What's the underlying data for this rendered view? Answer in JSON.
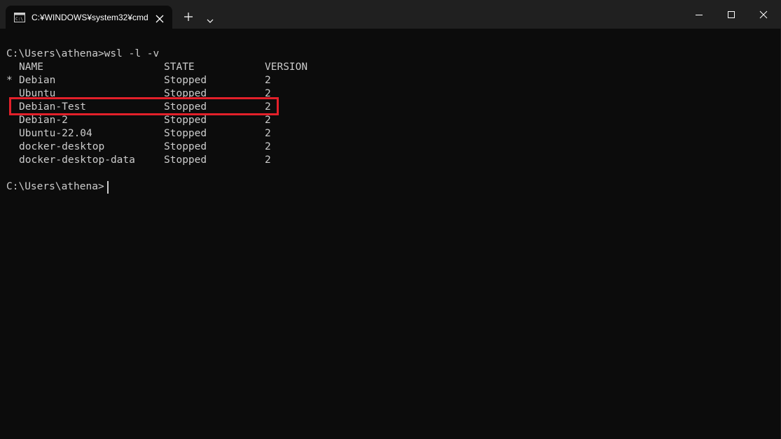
{
  "window": {
    "tab_title": "C:¥WINDOWS¥system32¥cmd",
    "tab_icon": "console-icon",
    "new_tab_icon": "plus-icon",
    "dropdown_icon": "chevron-down-icon",
    "controls": [
      "minimize-icon",
      "maximize-icon",
      "close-icon"
    ]
  },
  "console": {
    "command_line": "C:\\Users\\athena>wsl -l -v",
    "headers": {
      "name": "NAME",
      "state": "STATE",
      "version": "VERSION"
    },
    "rows": [
      {
        "marker": "*",
        "name": "Debian",
        "state": "Stopped",
        "version": "2"
      },
      {
        "marker": "",
        "name": "Ubuntu",
        "state": "Stopped",
        "version": "2"
      },
      {
        "marker": "",
        "name": "Debian-Test",
        "state": "Stopped",
        "version": "2"
      },
      {
        "marker": "",
        "name": "Debian-2",
        "state": "Stopped",
        "version": "2"
      },
      {
        "marker": "",
        "name": "Ubuntu-22.04",
        "state": "Stopped",
        "version": "2"
      },
      {
        "marker": "",
        "name": "docker-desktop",
        "state": "Stopped",
        "version": "2"
      },
      {
        "marker": "",
        "name": "docker-desktop-data",
        "state": "Stopped",
        "version": "2"
      }
    ],
    "prompt": "C:\\Users\\athena>",
    "highlighted_row": "Debian-Test"
  },
  "colors": {
    "background": "#0c0c0c",
    "titlebar": "#202020",
    "text": "#cccccc",
    "highlight": "#e3202a"
  }
}
